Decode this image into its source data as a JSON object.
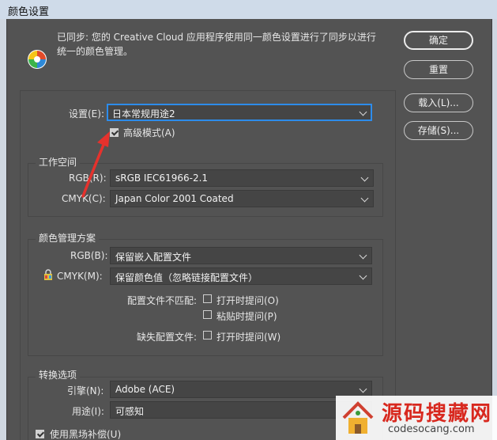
{
  "window": {
    "title": "颜色设置"
  },
  "sync_message": "已同步: 您的 Creative Cloud 应用程序使用同一颜色设置进行了同步以进行统一的颜色管理。",
  "buttons": {
    "ok": "确定",
    "reset": "重置",
    "load": "载入(L)...",
    "save": "存储(S)..."
  },
  "settings": {
    "label": "设置(E):",
    "value": "日本常规用途2"
  },
  "advanced_mode": {
    "label": "高级模式(A)",
    "checked": true
  },
  "working_spaces": {
    "title": "工作空间",
    "rgb_label": "RGB(R):",
    "rgb_value": "sRGB IEC61966-2.1",
    "cmyk_label": "CMYK(C):",
    "cmyk_value": "Japan Color 2001 Coated"
  },
  "color_management": {
    "title": "颜色管理方案",
    "rgb_label": "RGB(B):",
    "rgb_value": "保留嵌入配置文件",
    "cmyk_label": "CMYK(M):",
    "cmyk_value": "保留颜色值（忽略链接配置文件）",
    "mismatch_label": "配置文件不匹配:",
    "ask_open_label": "打开时提问(O)",
    "ask_paste_label": "粘贴时提问(P)",
    "missing_label": "缺失配置文件:",
    "missing_ask_open_label": "打开时提问(W)"
  },
  "conversion": {
    "title": "转换选项",
    "engine_label": "引擎(N):",
    "engine_value": "Adobe (ACE)",
    "intent_label": "用途(I):",
    "intent_value": "可感知",
    "black_point_label": "使用黑场补偿(U)"
  },
  "watermark": {
    "text": "源码搜藏网",
    "url": "codesocang.com"
  },
  "colors": {
    "dialog_bg": "#535353",
    "focus": "#2d8ceb",
    "arrow": "#e5322d"
  }
}
